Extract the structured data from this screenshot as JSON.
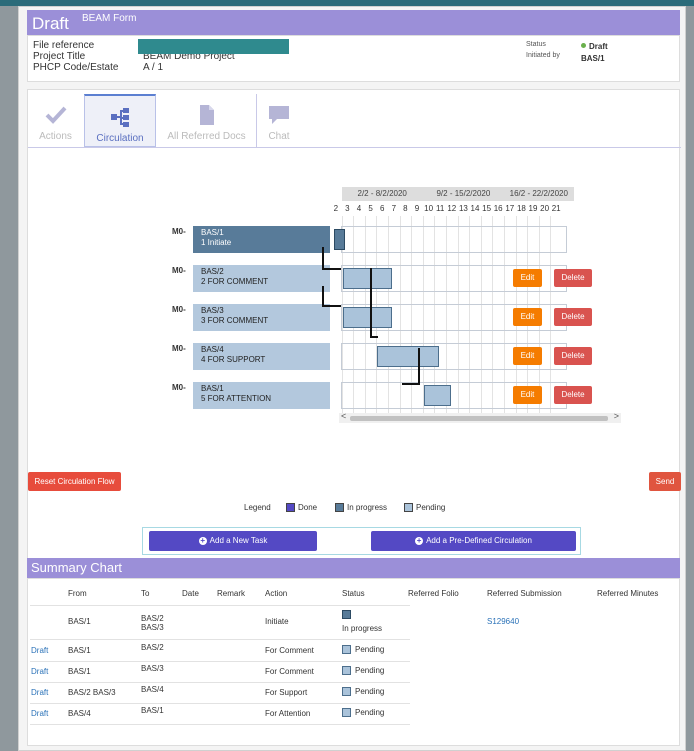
{
  "form": {
    "title": "Draft",
    "subtitle": "BEAM Form",
    "file_reference_label": "File reference",
    "project_title_label": "Project Title",
    "project_title_value": "BEAM Demo Project",
    "code_label": "PHCP Code/Estate",
    "code_value": "A / 1",
    "status_label": "Status",
    "status_value": "Draft",
    "initiated_label": "Initiated by",
    "initiated_value": "BAS/1"
  },
  "tabs": [
    {
      "label": "Actions",
      "icon": "checkmark-icon"
    },
    {
      "label": "Circulation",
      "icon": "flow-tree-icon"
    },
    {
      "label": "All Referred Docs",
      "icon": "document-icon"
    },
    {
      "label": "Chat",
      "icon": "chat-bubble-icon"
    }
  ],
  "gantt": {
    "weeks": [
      "2/2 - 8/2/2020",
      "9/2 - 15/2/2020",
      "16/2 - 22/2/2020"
    ],
    "days": [
      "2",
      "3",
      "4",
      "5",
      "6",
      "7",
      "8",
      "9",
      "10",
      "11",
      "12",
      "13",
      "14",
      "15",
      "16",
      "17",
      "18",
      "19",
      "20",
      "21"
    ],
    "tasks": [
      {
        "code": "M0-",
        "assignee": "BAS/1",
        "label": "1 Initiate"
      },
      {
        "code": "M0-",
        "assignee": "BAS/2",
        "label": "2 FOR COMMENT",
        "edit": "Edit",
        "delete": "Delete"
      },
      {
        "code": "M0-",
        "assignee": "BAS/3",
        "label": "3 FOR COMMENT",
        "edit": "Edit",
        "delete": "Delete"
      },
      {
        "code": "M0-",
        "assignee": "BAS/4",
        "label": "4 FOR SUPPORT",
        "edit": "Edit",
        "delete": "Delete"
      },
      {
        "code": "M0-",
        "assignee": "BAS/1",
        "label": "5 FOR ATTENTION",
        "edit": "Edit",
        "delete": "Delete"
      }
    ],
    "scroll_left": "<",
    "scroll_right": ">"
  },
  "buttons": {
    "reset": "Reset Circulation Flow",
    "send": "Send",
    "add_task": "Add a New Task",
    "add_predefined": "Add a Pre-Defined Circulation"
  },
  "legend": {
    "title": "Legend",
    "done": "Done",
    "in_progress": "In progress",
    "pending": "Pending"
  },
  "summary": {
    "title": "Summary Chart",
    "headers": [
      "From",
      "To",
      "Date",
      "Remark",
      "Action",
      "Status",
      "Referred Folio",
      "Referred Submission",
      "Referred Minutes"
    ],
    "rows": [
      {
        "prefix": "",
        "from": "BAS/1",
        "to1": "BAS/2",
        "to2": "BAS/3",
        "action": "Initiate",
        "status": "In progress",
        "submission": "S129640"
      },
      {
        "prefix": "Draft",
        "from": "BAS/1",
        "to1": "BAS/2",
        "to2": "",
        "action": "For Comment",
        "status": "Pending",
        "submission": ""
      },
      {
        "prefix": "Draft",
        "from": "BAS/1",
        "to1": "BAS/3",
        "to2": "",
        "action": "For Comment",
        "status": "Pending",
        "submission": ""
      },
      {
        "prefix": "Draft",
        "from": "BAS/2 BAS/3",
        "to1": "BAS/4",
        "to2": "",
        "action": "For Support",
        "status": "Pending",
        "submission": ""
      },
      {
        "prefix": "Draft",
        "from": "BAS/4",
        "to1": "BAS/1",
        "to2": "",
        "action": "For Attention",
        "status": "Pending",
        "submission": ""
      }
    ]
  },
  "colors": {
    "header_purple": "#9b8fd8",
    "done": "#5449c4",
    "in_progress": "#587b99",
    "pending": "#aac3da",
    "edit": "#f57c00",
    "delete": "#d9534f"
  }
}
